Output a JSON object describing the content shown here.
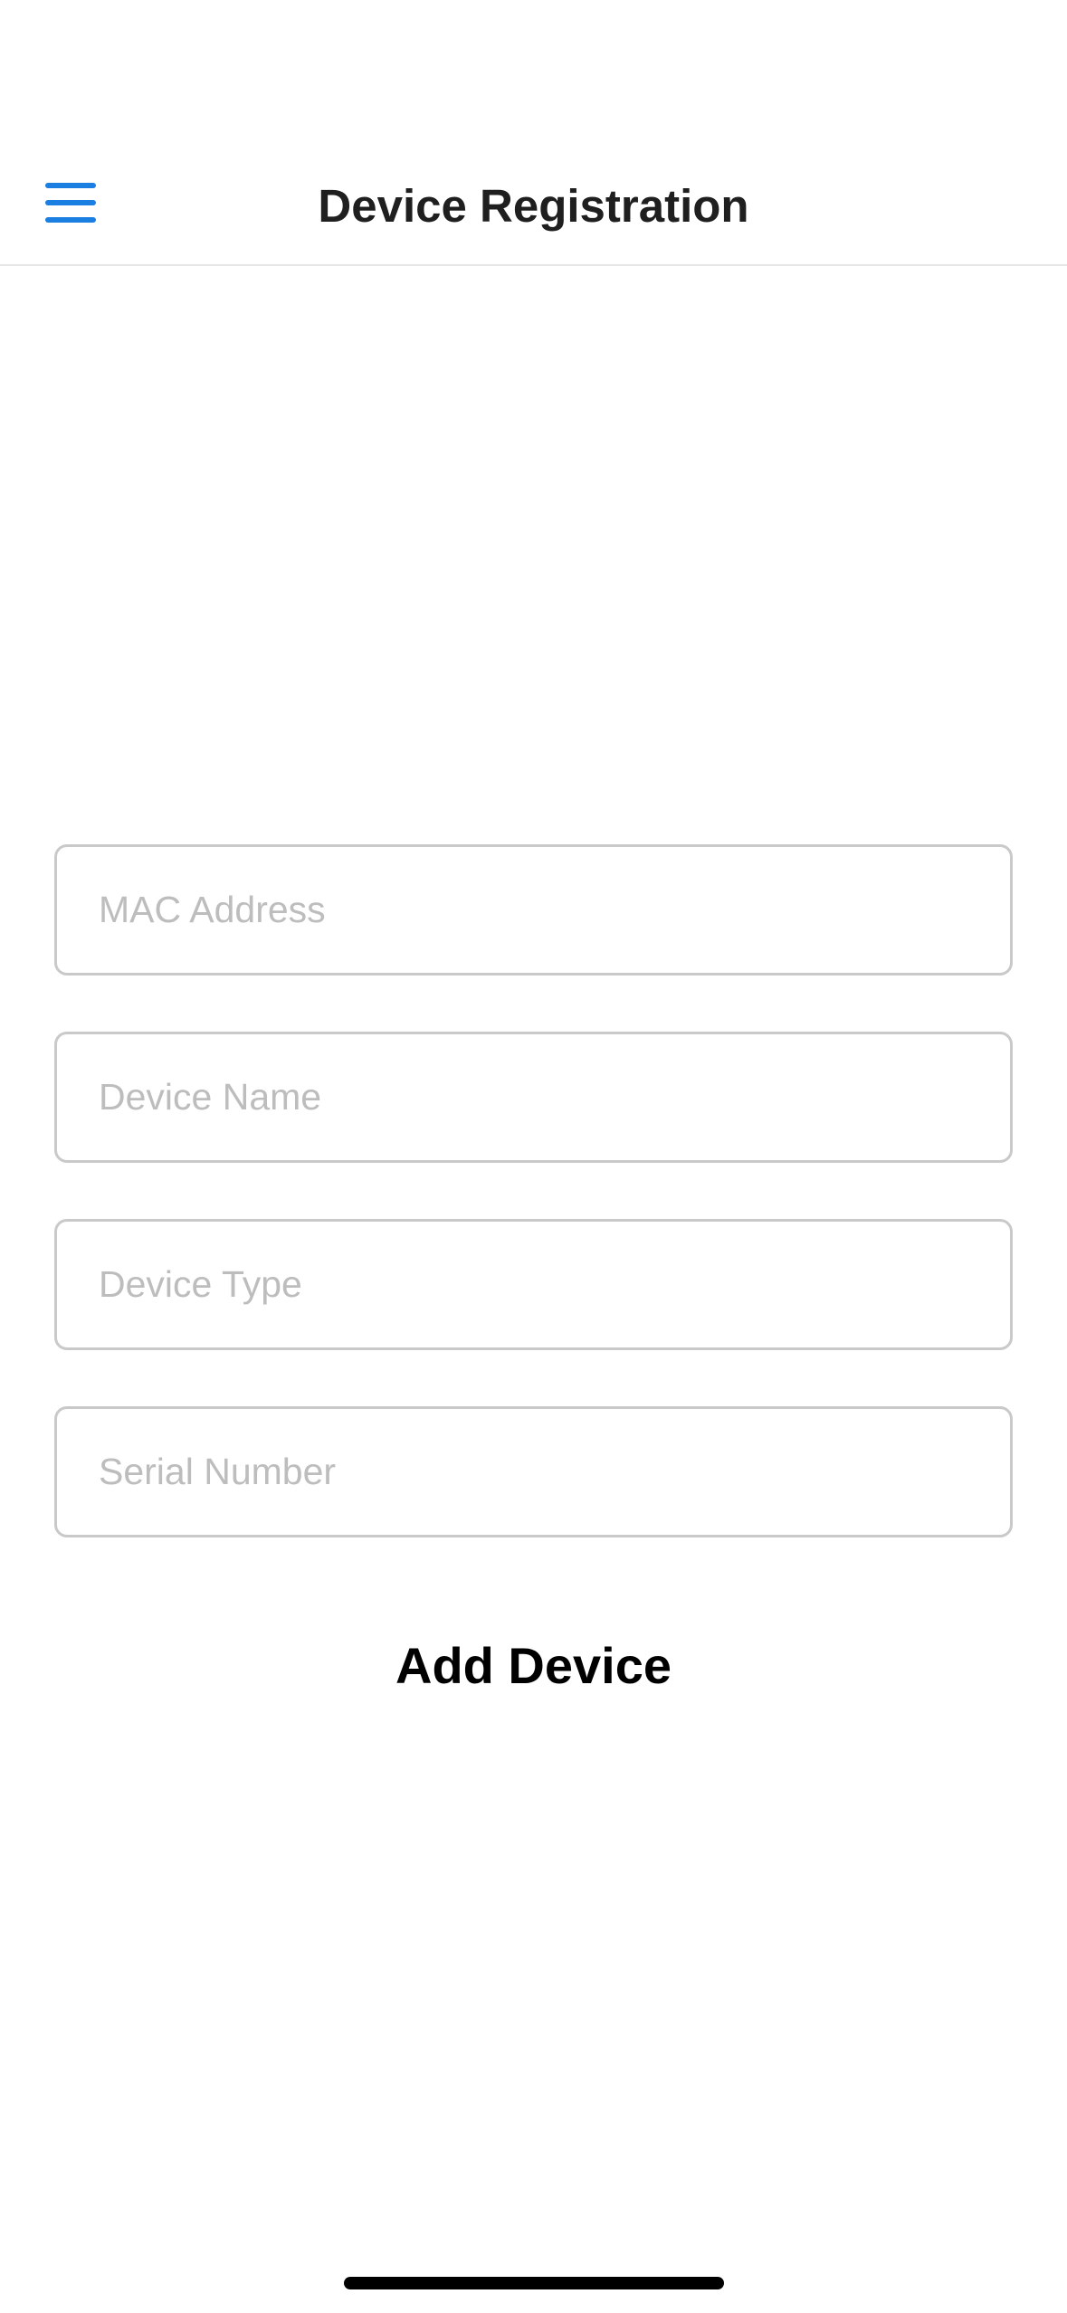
{
  "header": {
    "title": "Device Registration",
    "menu_icon": "hamburger-menu-icon"
  },
  "form": {
    "fields": [
      {
        "placeholder": "MAC Address",
        "value": ""
      },
      {
        "placeholder": "Device Name",
        "value": ""
      },
      {
        "placeholder": "Device Type",
        "value": ""
      },
      {
        "placeholder": "Serial Number",
        "value": ""
      }
    ],
    "submit_label": "Add Device"
  },
  "colors": {
    "accent": "#1a7fe0",
    "title_text": "#1f1f1f",
    "field_border": "#c9c9c9",
    "placeholder": "#bdbdbd",
    "divider": "#e6e6e6"
  }
}
